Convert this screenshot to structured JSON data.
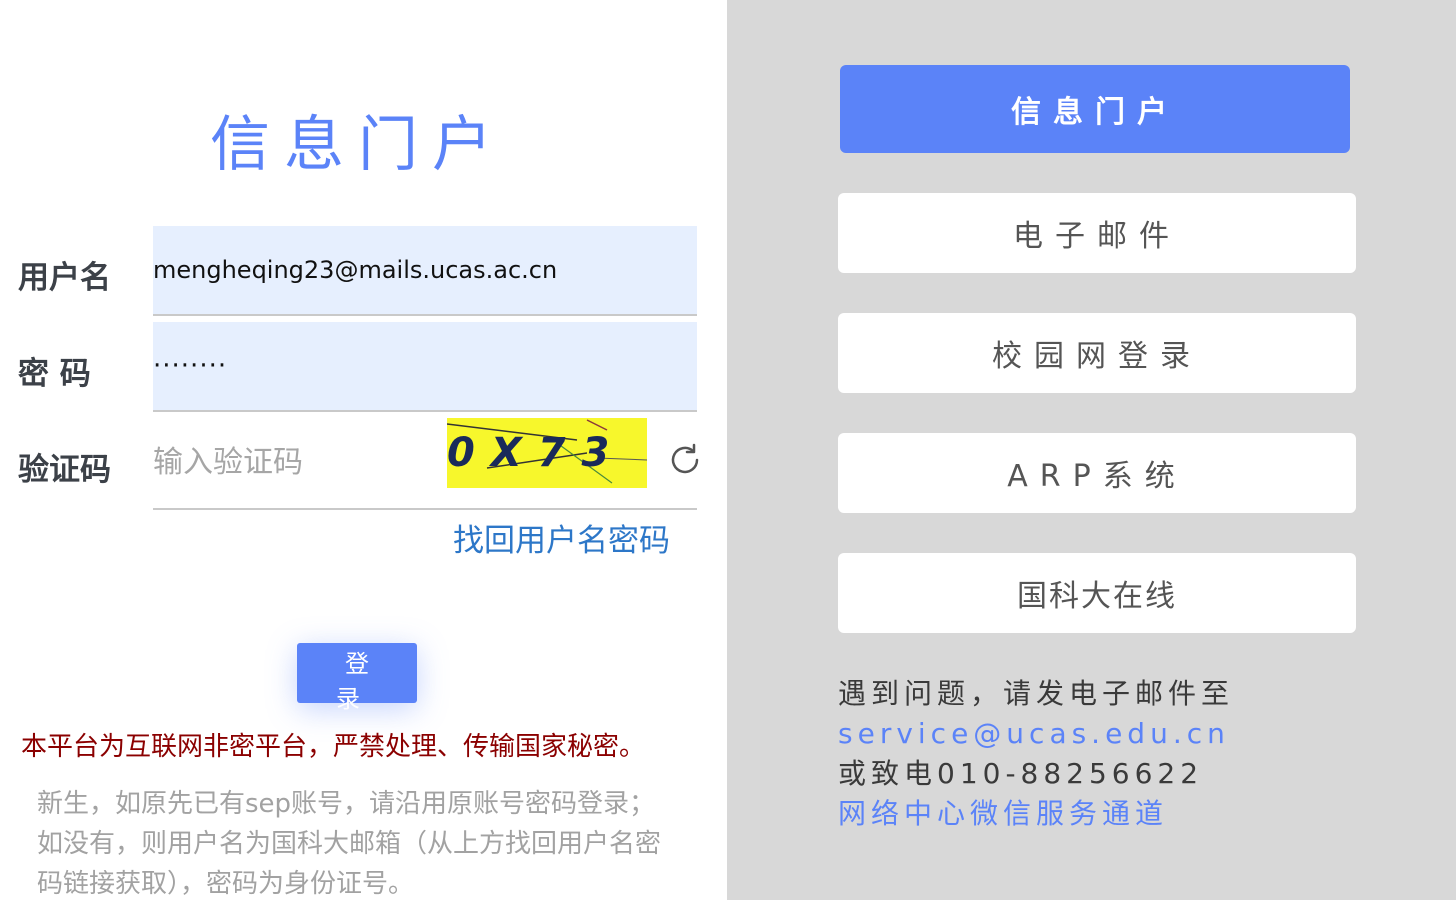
{
  "login": {
    "title": "信息门户",
    "username_label": "用户名",
    "username_value": "mengheqing23@mails.ucas.ac.cn",
    "password_label": "密 码",
    "password_value": "········",
    "captcha_label": "验证码",
    "captcha_placeholder": "输入验证码",
    "captcha_text": "0X73",
    "forgot_link": "找回用户名密码",
    "login_button": "登 录",
    "warning": "本平台为互联网非密平台，严禁处理、传输国家秘密。",
    "note": "新生，如原先已有sep账号，请沿用原账号密码登录；如没有，则用户名为国科大邮箱（从上方找回用户名密码链接获取），密码为身份证号。"
  },
  "nav": {
    "items": [
      {
        "label": "信息门户",
        "active": true
      },
      {
        "label": "电子邮件",
        "active": false
      },
      {
        "label": "校园网登录",
        "active": false
      },
      {
        "label": "ARP系统",
        "active": false
      },
      {
        "label": "国科大在线",
        "active": false
      }
    ]
  },
  "help": {
    "line1": "遇到问题，请发电子邮件至",
    "email": "service@ucas.edu.cn",
    "phone": "或致电010-88256622",
    "wechat": "网络中心微信服务通道"
  },
  "colors": {
    "accent": "#5b83f8",
    "warning": "#8b0000",
    "link": "#2d77c8",
    "input_bg": "#e6effe",
    "right_panel_bg": "#d8d8d8"
  },
  "icons": {
    "refresh": "refresh-icon"
  }
}
